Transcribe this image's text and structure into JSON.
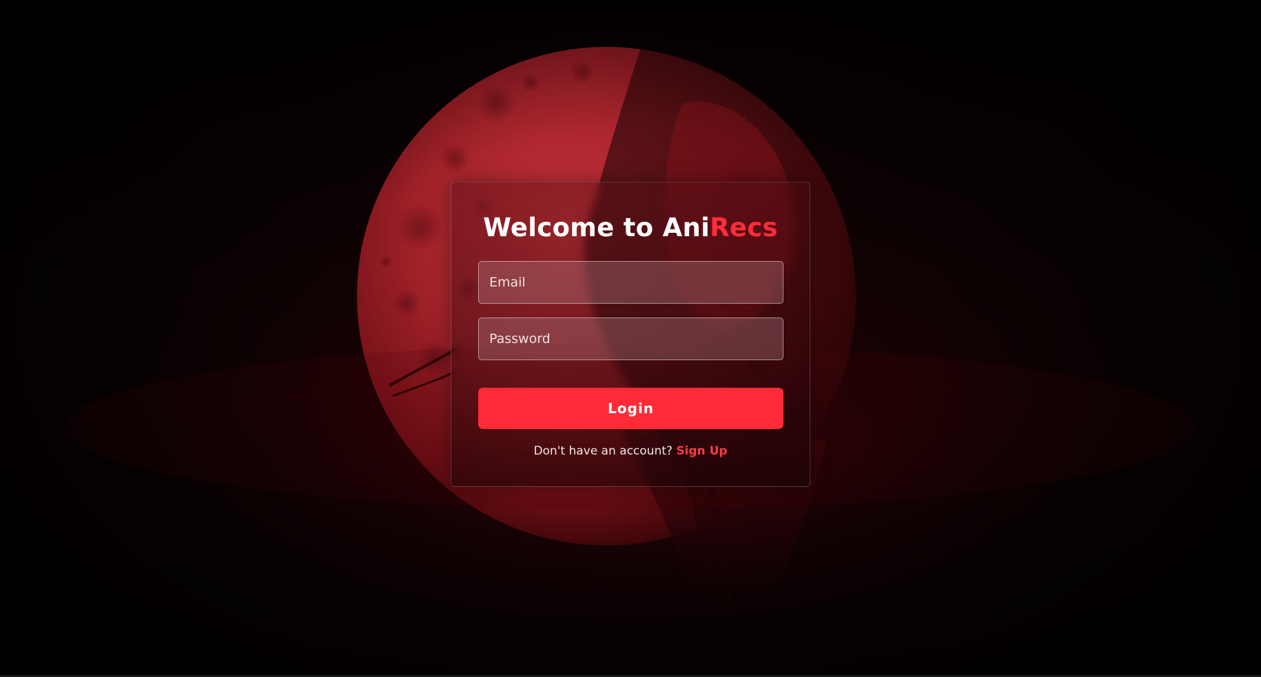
{
  "app": {
    "title_prefix": "Welcome to Ani",
    "title_accent": "Recs"
  },
  "form": {
    "email_placeholder": "Email",
    "password_placeholder": "Password",
    "login_label": "Login",
    "signup_prompt": "Don't have an account?",
    "signup_link": "Sign Up"
  },
  "colors": {
    "accent": "#ff2b37",
    "background": "#050102",
    "moon": "#a11a22"
  },
  "icons": {
    "background_art": "blood-moon-illustration"
  }
}
